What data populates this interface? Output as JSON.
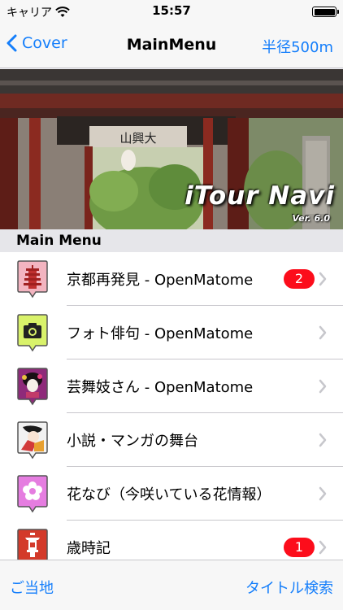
{
  "status_bar": {
    "carrier": "キャリア",
    "time": "15:57"
  },
  "nav": {
    "back_label": "Cover",
    "title": "MainMenu",
    "right_label": "半径500m"
  },
  "banner": {
    "title": "iTour Navi",
    "version": "Ver. 6.0"
  },
  "section_header": "Main Menu",
  "menu_items": [
    {
      "label": "京都再発見 - OpenMatome",
      "badge": "2",
      "icon": "pagoda-icon",
      "icon_bg": "#f3b4c0"
    },
    {
      "label": "フォト俳句 - OpenMatome",
      "badge": "",
      "icon": "camera-icon",
      "icon_bg": "#d9f26a"
    },
    {
      "label": "芸舞妓さん - OpenMatome",
      "badge": "",
      "icon": "maiko-icon",
      "icon_bg": "#8e2a7a"
    },
    {
      "label": "小説・マンガの舞台",
      "badge": "",
      "icon": "manga-icon",
      "icon_bg": "#f2f2f2"
    },
    {
      "label": "花なび（今咲いている花情報）",
      "badge": "",
      "icon": "flower-icon",
      "icon_bg": "#e57de0"
    },
    {
      "label": "歳時記",
      "badge": "1",
      "icon": "lantern-icon",
      "icon_bg": "#d33a2a"
    }
  ],
  "toolbar": {
    "left_label": "ご当地",
    "right_label": "タイトル検索"
  },
  "colors": {
    "accent": "#147efb",
    "badge": "#fc0d1b",
    "chevron": "#c7c7cc"
  }
}
